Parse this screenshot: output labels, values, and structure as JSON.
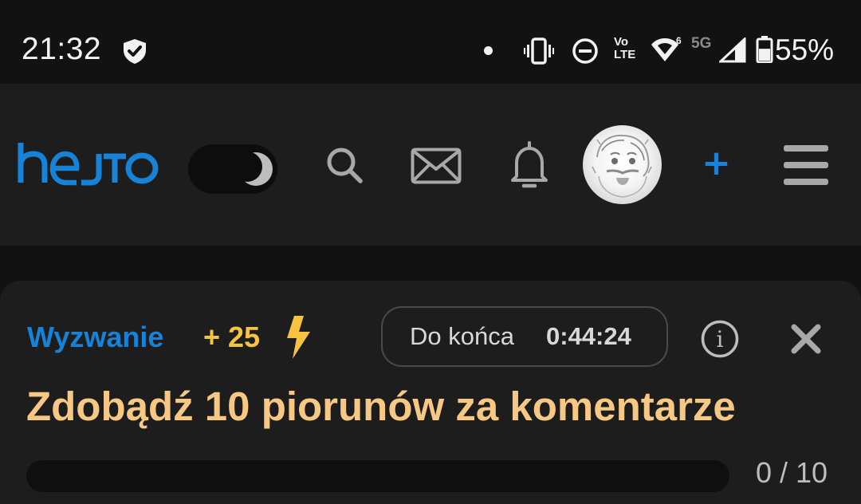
{
  "status_bar": {
    "time": "21:32",
    "network_5g": "5G",
    "volte_top": "Vo",
    "volte_bottom": "LTE",
    "wifi_badge": "6",
    "battery_percent": "55%",
    "battery_level": 0.55
  },
  "header": {
    "logo_text": "hejto",
    "dark_mode_on": true,
    "add_label": "+"
  },
  "challenge": {
    "label": "Wyzwanie",
    "points": "+ 25",
    "timer_label": "Do końca",
    "timer_value": "0:44:24",
    "info_label": "i",
    "title": "Zdobądź 10 piorunów za komentarze",
    "progress_current": 0,
    "progress_total": 10,
    "progress_text": "0 / 10"
  },
  "colors": {
    "brand_blue": "#1682d8",
    "points_yellow": "#f5c242",
    "title_gold": "#f7c884",
    "header_bg": "#1d1d1d",
    "page_bg": "#121212"
  }
}
